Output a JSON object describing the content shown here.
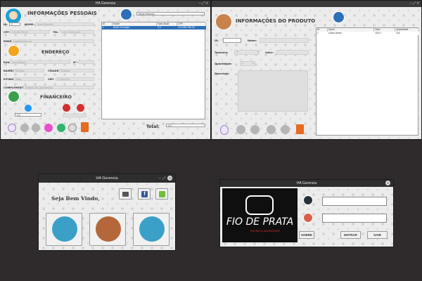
{
  "colors": {
    "desktop": "#2f2b2c",
    "accent_blue": "#2d6fb8",
    "danger": "#d32f2f",
    "green": "#4caf50",
    "teal": "#3aa0c8"
  },
  "w1": {
    "title": "HA Gerencia",
    "heading_personal": "INFORMAÇÕES PESSOAIS",
    "search_value": "Nome Exemplo",
    "labels": {
      "id": "ID:",
      "nome": "NOME:",
      "cpf": "CPF:",
      "tel": "TEL:",
      "email": "EMAIL:",
      "endereco": "ENDEREÇO",
      "rua": "RUA:",
      "n": "N°:",
      "bairro": "BAIRRO:",
      "cidade": "CIDADE:",
      "estado": "ESTADO:",
      "cep": "CEP:",
      "complemento": "COMPLEMENTO:",
      "financeiro": "FINANCEIRO",
      "total": "Total:"
    },
    "fields": {
      "id": "1",
      "nome": "Nome Exemplo",
      "cpf": "123.456.789-00",
      "tel": "(11) 2 3333-4444",
      "email": "email@email.com",
      "rua": "Rua Exemplo",
      "n": "",
      "bairro": "Exemplo",
      "cidade": "Exemplo",
      "estado": "Maga",
      "cep": "12.333-333",
      "complemento": "Exemplo de Complemento",
      "financeiro": "0.0",
      "total": "0.0"
    },
    "table": {
      "headers": [
        "ID",
        "Nome",
        "Valor Atual",
        "CPF"
      ],
      "rows": [
        [
          "1",
          "Nome Exemplo",
          "0.0",
          "123.456.789-00"
        ]
      ]
    }
  },
  "w2": {
    "title": "",
    "heading": "INFORMAÇÕES DO PRODUTO",
    "labels": {
      "id": "ID:",
      "nome": "Nome:",
      "tamanho": "Tamanho:",
      "valor": "Valor:",
      "quantidade": "Quantidade:",
      "descricao": "Descrição:"
    },
    "tamanho_value": "M",
    "quantidade_value": "0",
    "table": {
      "headers": [
        "ID",
        "Nome",
        "Valor",
        "Quantidade"
      ],
      "rows": [
        [
          "1",
          "Calça Jeans",
          "100.0",
          "100"
        ]
      ]
    }
  },
  "w3": {
    "title": "HA Gerencia",
    "welcome": "Seja Bem Vindo,"
  },
  "w4": {
    "title": "HA Gerencia",
    "logo_text": "FIO DE PRATA",
    "logo_sub": "ROUPAS E ACESSÓRIOS",
    "buttons": {
      "sobre": "SOBRE",
      "entrar": "ENTRAR",
      "sair": "SAIR"
    }
  }
}
